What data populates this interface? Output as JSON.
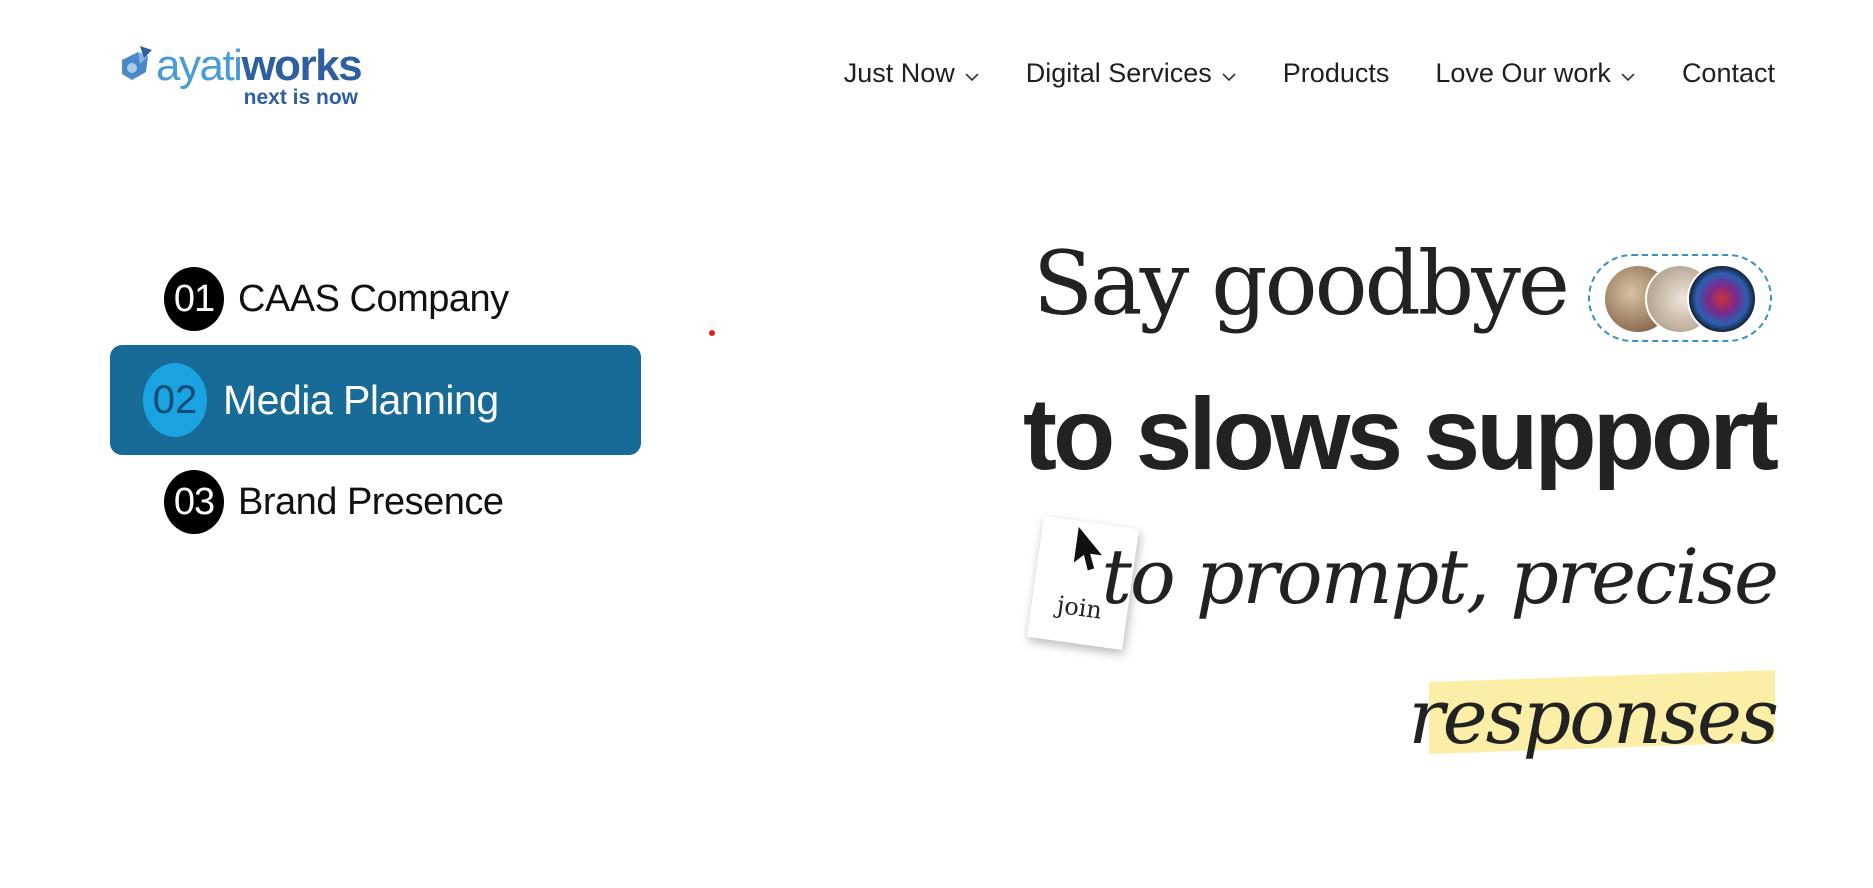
{
  "logo": {
    "word_light": "ayati",
    "word_bold": "works",
    "tagline": "next is now",
    "icon": "logo-mark-icon",
    "colors": {
      "light": "#4a9bd6",
      "dark": "#2e5fa0"
    }
  },
  "nav": {
    "items": [
      {
        "label": "Just Now",
        "dropdown": true
      },
      {
        "label": "Digital Services",
        "dropdown": true
      },
      {
        "label": "Products",
        "dropdown": false
      },
      {
        "label": "Love Our work",
        "dropdown": true
      },
      {
        "label": "Contact",
        "dropdown": false
      }
    ]
  },
  "services": {
    "items": [
      {
        "number": "01",
        "label": "CAAS Company",
        "active": false
      },
      {
        "number": "02",
        "label": "Media Planning",
        "active": true
      },
      {
        "number": "03",
        "label": "Brand Presence",
        "active": false
      }
    ],
    "colors": {
      "active_bg": "#176b96",
      "active_num_bg": "#1aa3e0",
      "num_bg": "#000000"
    }
  },
  "hero": {
    "line1": "Say goodbye",
    "line2": "to slows support",
    "line3": "to prompt, precise",
    "line4": "responses",
    "join_label": "join",
    "highlight_color": "#fbeea6"
  }
}
